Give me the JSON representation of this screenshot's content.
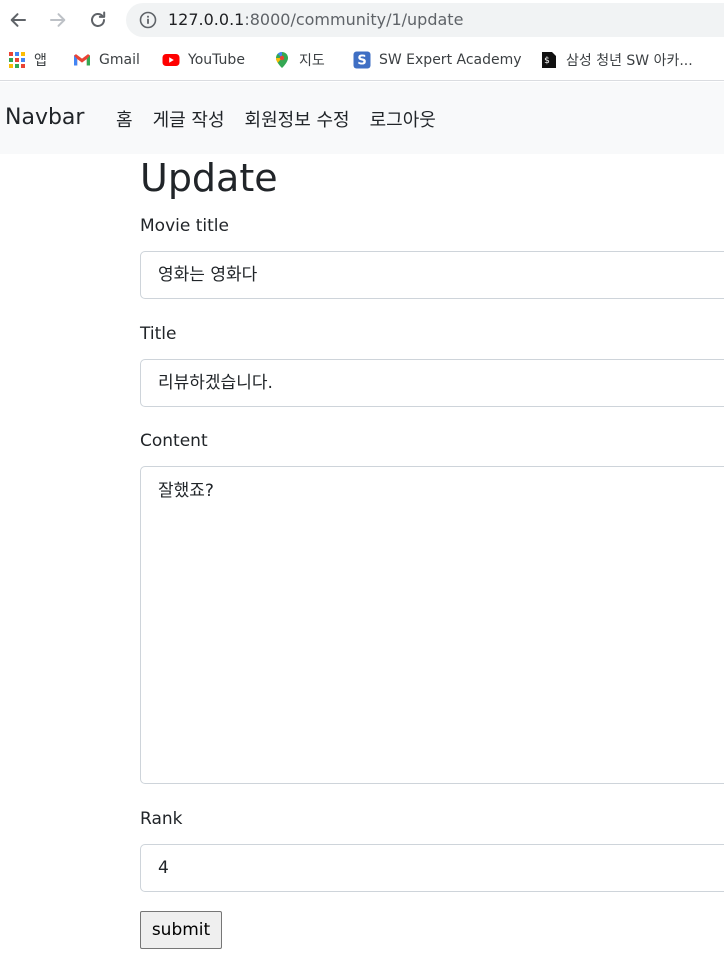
{
  "browser": {
    "url_host": "127.0.0.1",
    "url_rest": ":8000/community/1/update",
    "bookmarks": [
      {
        "label": "앱",
        "icon": "apps-grid-icon"
      },
      {
        "label": "Gmail",
        "icon": "gmail-icon"
      },
      {
        "label": "YouTube",
        "icon": "youtube-icon"
      },
      {
        "label": "지도",
        "icon": "maps-pin-icon"
      },
      {
        "label": "SW Expert Academy",
        "icon": "swea-icon"
      },
      {
        "label": "삼성 청년 SW 아카...",
        "icon": "ssafy-icon"
      }
    ]
  },
  "navbar": {
    "brand": "Navbar",
    "links": [
      "홈",
      "게글 작성",
      "회원정보 수정",
      "로그아웃"
    ]
  },
  "form": {
    "title": "Update",
    "movie_title_label": "Movie title",
    "movie_title_value": "영화는 영화다",
    "title_label": "Title",
    "title_value": "리뷰하겠습니다.",
    "content_label": "Content",
    "content_value": "잘했죠?",
    "rank_label": "Rank",
    "rank_value": "4",
    "submit_label": "submit"
  },
  "colors": {
    "navbar_bg": "#f8f9fa",
    "omnibox_bg": "#f1f3f4",
    "field_border": "#ced4da"
  }
}
